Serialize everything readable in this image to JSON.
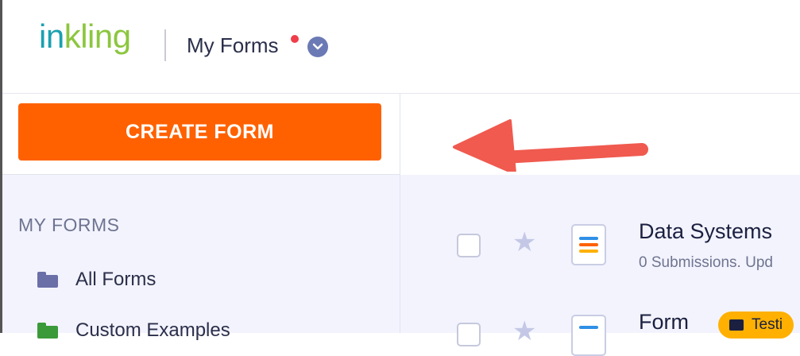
{
  "header": {
    "logo_part1": "in",
    "logo_part2": "kling",
    "title": "My Forms"
  },
  "sidebar": {
    "create_button": "CREATE FORM",
    "section_title": "MY FORMS",
    "items": [
      {
        "label": "All Forms",
        "icon": "folder-icon"
      },
      {
        "label": "Custom Examples",
        "icon": "folder-icon"
      }
    ]
  },
  "forms": [
    {
      "name": "Data Systems",
      "meta": "0 Submissions. Upd"
    },
    {
      "name": "Form",
      "tag": "Testi"
    }
  ],
  "colors": {
    "accent": "#ff6100",
    "logo_teal": "#1aa0b0",
    "logo_green": "#8cc63f",
    "tag": "#ffb000",
    "notification_dot": "#ef3e4a"
  }
}
